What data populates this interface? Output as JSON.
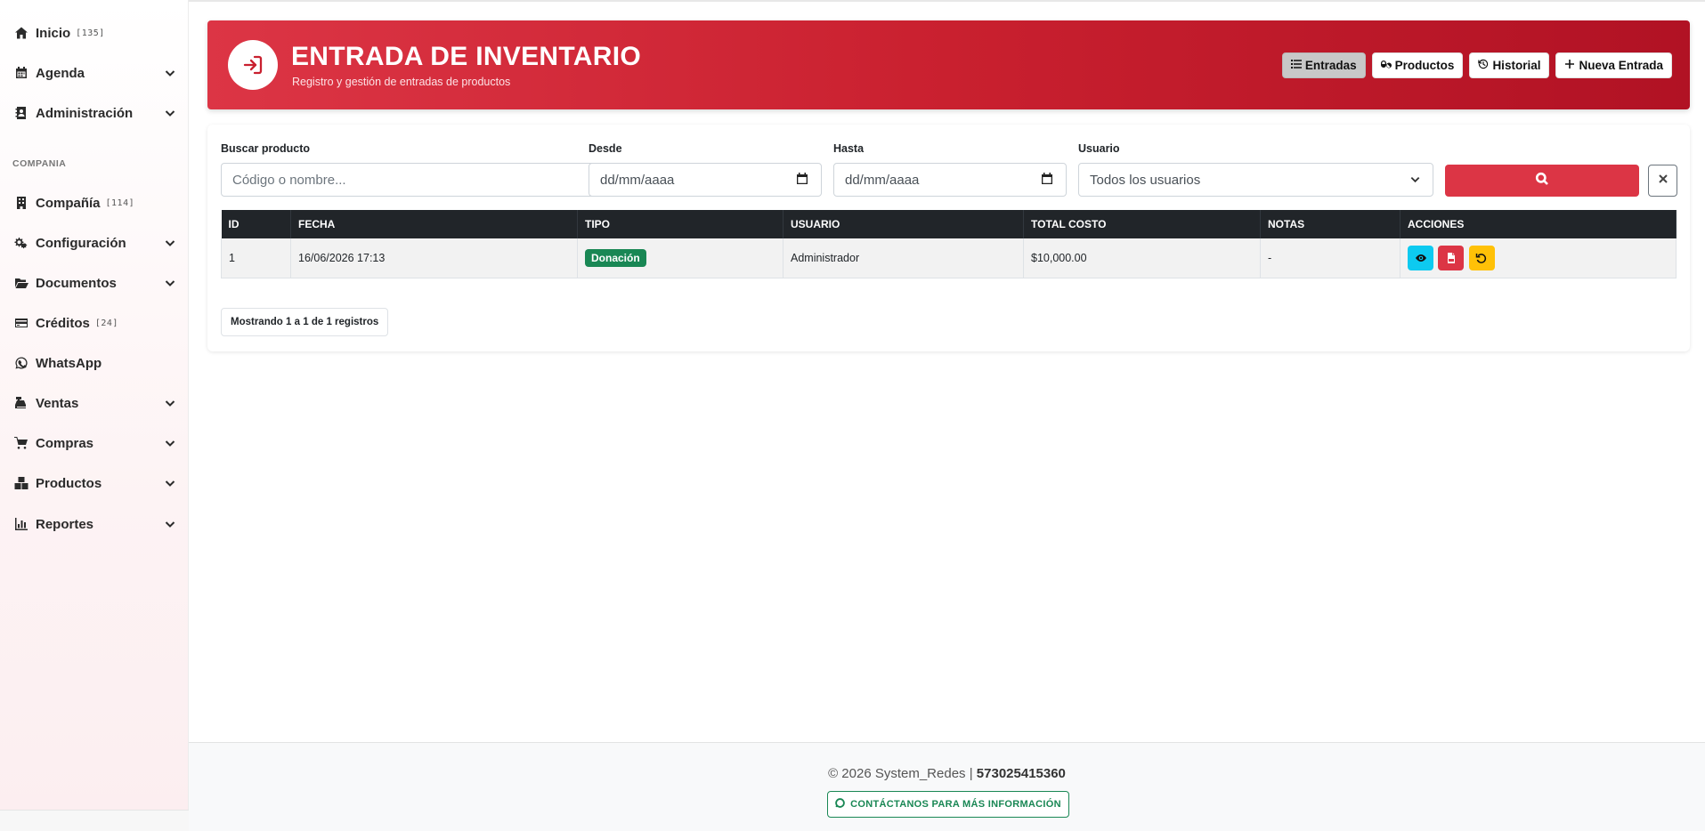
{
  "sidebar": {
    "items": [
      {
        "label": "Inicio",
        "count": "[135]",
        "icon": "home-icon",
        "has_chevron": false
      },
      {
        "label": "Agenda",
        "count": "",
        "icon": "calendar-icon",
        "has_chevron": true
      },
      {
        "label": "Administración",
        "count": "",
        "icon": "contact-book-icon",
        "has_chevron": true
      },
      {
        "label": "Compañía",
        "count": "[114]",
        "icon": "building-icon",
        "has_chevron": false
      },
      {
        "label": "Configuración",
        "count": "",
        "icon": "gears-icon",
        "has_chevron": true
      },
      {
        "label": "Documentos",
        "count": "",
        "icon": "folder-open-icon",
        "has_chevron": true
      },
      {
        "label": "Créditos",
        "count": "[24]",
        "icon": "credit-card-icon",
        "has_chevron": false
      },
      {
        "label": "WhatsApp",
        "count": "",
        "icon": "whatsapp-icon",
        "has_chevron": false
      },
      {
        "label": "Ventas",
        "count": "",
        "icon": "cash-register-icon",
        "has_chevron": true
      },
      {
        "label": "Compras",
        "count": "",
        "icon": "cart-icon",
        "has_chevron": true
      },
      {
        "label": "Productos",
        "count": "",
        "icon": "boxes-icon",
        "has_chevron": true
      },
      {
        "label": "Reportes",
        "count": "",
        "icon": "chart-bar-icon",
        "has_chevron": true
      }
    ],
    "section_label": "COMPANIA"
  },
  "header": {
    "title": "ENTRADA DE INVENTARIO",
    "subtitle": "Registro y gestión de entradas de productos",
    "buttons": [
      {
        "label": "Entradas",
        "icon": "list-icon",
        "active": true
      },
      {
        "label": "Productos",
        "icon": "pills-icon",
        "active": false
      },
      {
        "label": "Historial",
        "icon": "history-icon",
        "active": false
      },
      {
        "label": "Nueva Entrada",
        "icon": "plus-icon",
        "active": false
      }
    ]
  },
  "filters": {
    "search_label": "Buscar producto",
    "search_placeholder": "Código o nombre...",
    "from_label": "Desde",
    "from_placeholder": "dd/mm/aaaa",
    "to_label": "Hasta",
    "to_placeholder": "dd/mm/aaaa",
    "user_label": "Usuario",
    "user_selected": "Todos los usuarios"
  },
  "table": {
    "headers": [
      "ID",
      "FECHA",
      "TIPO",
      "USUARIO",
      "TOTAL COSTO",
      "NOTAS",
      "ACCIONES"
    ],
    "rows": [
      {
        "id": "1",
        "fecha": "16/06/2026 17:13",
        "tipo": "Donación",
        "usuario": "Administrador",
        "total": "$10,000.00",
        "notas": "-"
      }
    ]
  },
  "pagination": {
    "prefix": "Mostrando",
    "from": "1",
    "sep1": "a",
    "to": "1",
    "sep2": "de",
    "total": "1",
    "suffix": "registros"
  },
  "footer": {
    "copyright": "© 2026 System_Redes |",
    "phone": "573025415360",
    "contact_label": "CONTÁCTANOS PARA MÁS INFORMACIÓN"
  },
  "colors": {
    "brand_red": "#dc3545",
    "success_green": "#198754",
    "info_cyan": "#0dcaf0",
    "warning_yellow": "#ffc107",
    "table_header": "#212529"
  }
}
